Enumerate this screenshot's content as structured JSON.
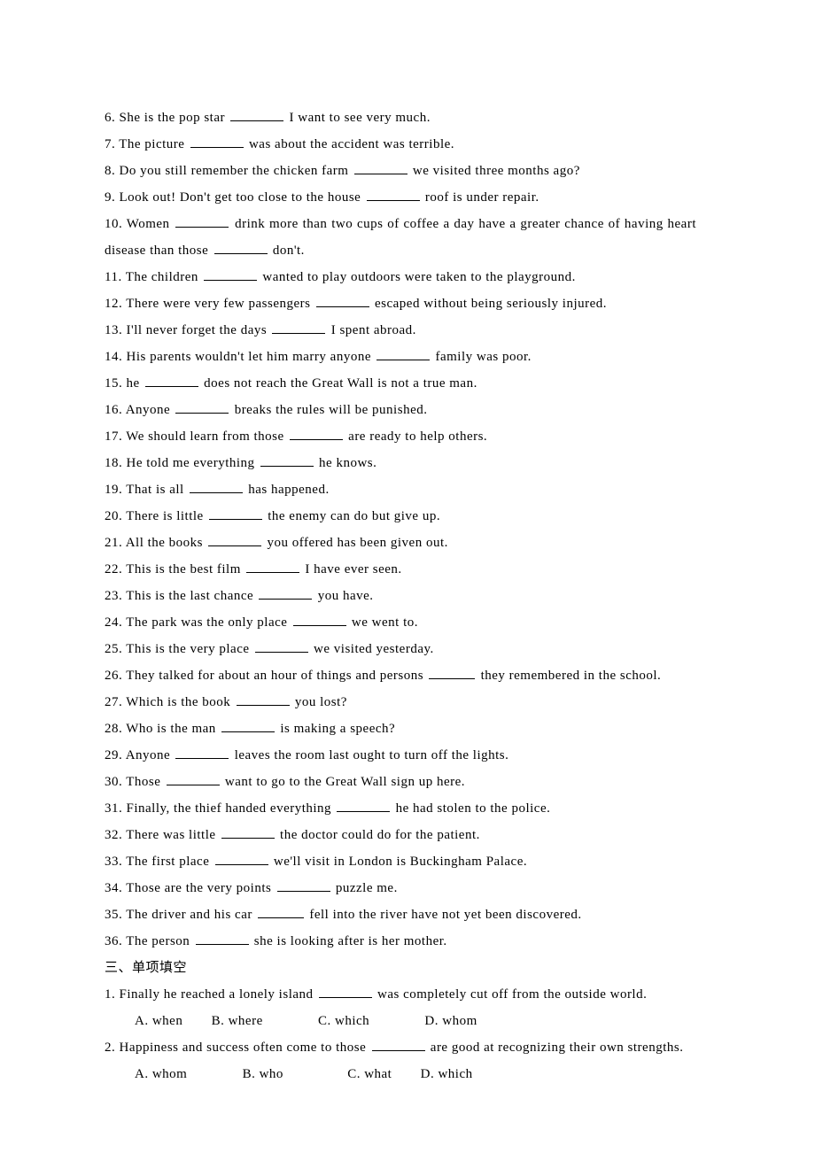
{
  "fill": {
    "q6": {
      "n": "6. ",
      "a": "She is the pop star ",
      "b": " I want to see very much."
    },
    "q7": {
      "n": "7. ",
      "a": "The picture ",
      "b": " was about the accident was terrible."
    },
    "q8": {
      "n": "8. ",
      "a": "Do you still remember the chicken farm ",
      "b": " we visited three months ago?"
    },
    "q9": {
      "n": "9. ",
      "a": "Look out! Don't get too close to the house ",
      "b": " roof is under repair."
    },
    "q10": {
      "n": "10. ",
      "a": "Women ",
      "b": " drink more than two cups of coffee a day have a greater chance of having heart disease than those ",
      "c": " don't."
    },
    "q11": {
      "n": "11. ",
      "a": "The children ",
      "b": " wanted to play outdoors were taken to the playground."
    },
    "q12": {
      "n": "12. ",
      "a": "There were very few passengers ",
      "b": " escaped without being seriously injured."
    },
    "q13": {
      "n": "13. ",
      "a": "I'll never forget the days ",
      "b": " I spent abroad."
    },
    "q14": {
      "n": "14. ",
      "a": "His parents wouldn't let him marry anyone ",
      "b": " family was poor."
    },
    "q15": {
      "n": "15. ",
      "a": "he ",
      "b": " does not reach the Great Wall is not a true man."
    },
    "q16": {
      "n": "16. ",
      "a": "Anyone ",
      "b": " breaks the rules will be punished."
    },
    "q17": {
      "n": "17. ",
      "a": "We should learn from those ",
      "b": " are ready to help others."
    },
    "q18": {
      "n": "18. ",
      "a": "He told me everything ",
      "b": " he knows."
    },
    "q19": {
      "n": "19. ",
      "a": "That is all ",
      "b": " has happened."
    },
    "q20": {
      "n": "20. ",
      "a": "There is little ",
      "b": " the enemy can do but give up."
    },
    "q21": {
      "n": "21. ",
      "a": "All the books ",
      "b": " you offered has been given out."
    },
    "q22": {
      "n": "22. ",
      "a": "This is the best film ",
      "b": " I have ever seen."
    },
    "q23": {
      "n": "23. ",
      "a": "This is the last chance ",
      "b": " you have."
    },
    "q24": {
      "n": "24. ",
      "a": "The park was the only place ",
      "b": " we went to."
    },
    "q25": {
      "n": "25. ",
      "a": "This is the very place ",
      "b": " we visited yesterday."
    },
    "q26": {
      "n": "26. ",
      "a": "They talked for about an hour of things and persons ",
      "b": " they remembered in the school."
    },
    "q27": {
      "n": "27. ",
      "a": "Which is the book ",
      "b": " you lost?"
    },
    "q28": {
      "n": "28. ",
      "a": "Who is the man ",
      "b": " is making a speech?"
    },
    "q29": {
      "n": "29. ",
      "a": "Anyone ",
      "b": " leaves the room last ought to turn off the lights."
    },
    "q30": {
      "n": "30. ",
      "a": "Those ",
      "b": " want to go to the Great Wall sign up here."
    },
    "q31": {
      "n": "31. ",
      "a": "Finally, the thief handed everything ",
      "b": " he had stolen to the police."
    },
    "q32": {
      "n": "32. ",
      "a": "There was little ",
      "b": " the doctor could do for the patient."
    },
    "q33": {
      "n": "33. ",
      "a": "The first place ",
      "b": " we'll visit in London is Buckingham Palace."
    },
    "q34": {
      "n": "34. ",
      "a": "Those are the very points ",
      "b": " puzzle me."
    },
    "q35": {
      "n": "35. ",
      "a": "The driver and his car ",
      "b": " fell into the river have not yet been discovered."
    },
    "q36": {
      "n": "36. ",
      "a": "The person ",
      "b": " she is looking after is her mother."
    }
  },
  "section3": "三、单项填空",
  "mcq": {
    "q1": {
      "n": "1. ",
      "a": "Finally he reached a lonely island ",
      "b": " was completely cut off from the outside world.",
      "optA": "A. when",
      "optB": "B. where",
      "optC": "C. which",
      "optD": "D. whom"
    },
    "q2": {
      "n": "2. ",
      "a": "Happiness and success often come to those ",
      "b": " are good at recognizing their own strengths.",
      "optA": "A. whom",
      "optB": "B. who",
      "optC": "C. what",
      "optD": "D. which"
    }
  }
}
